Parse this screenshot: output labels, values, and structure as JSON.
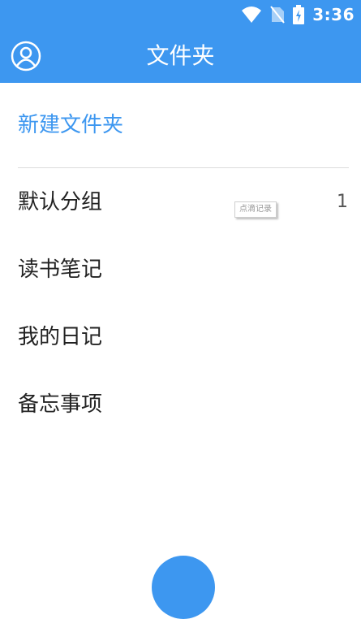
{
  "status_bar": {
    "time": "3:36",
    "icons": [
      "wifi-icon",
      "no-sim-icon",
      "battery-charging-icon"
    ]
  },
  "toolbar": {
    "title": "文件夹",
    "avatar_icon": "user-circle-icon"
  },
  "new_folder_label": "新建文件夹",
  "folders": [
    {
      "label": "默认分组",
      "count": "1",
      "tooltip": "点滴记录"
    },
    {
      "label": "读书笔记"
    },
    {
      "label": "我的日记"
    },
    {
      "label": "备忘事项"
    }
  ],
  "colors": {
    "primary": "#3d97f0",
    "text": "#222222",
    "divider": "#dcdcdc"
  }
}
